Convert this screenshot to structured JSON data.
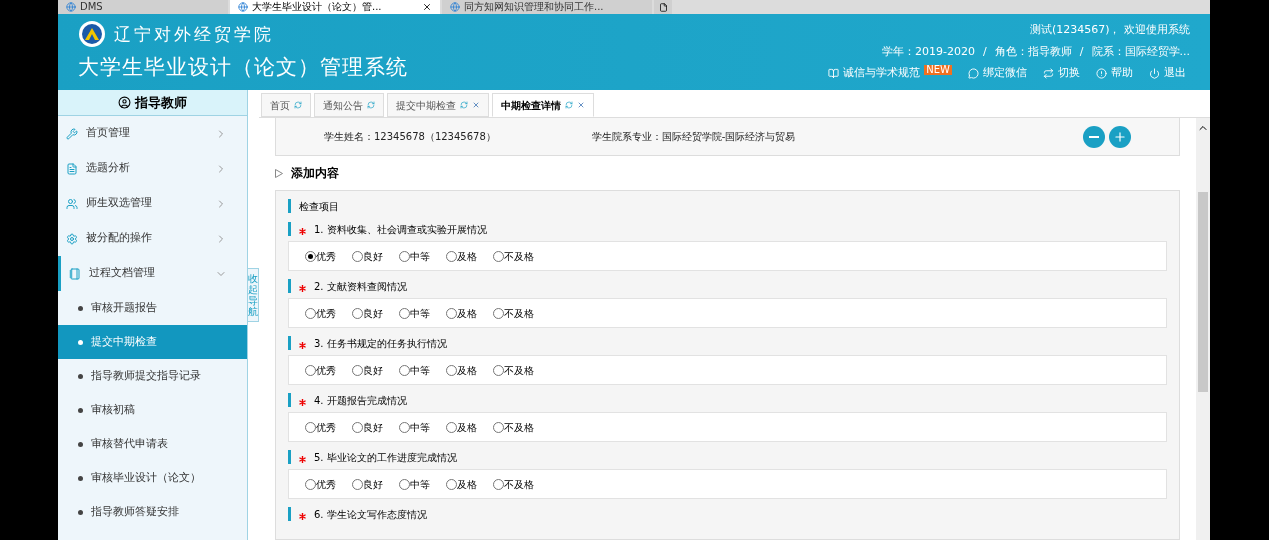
{
  "browser_tabs": [
    {
      "label": "DMS",
      "selected": false
    },
    {
      "label": "大学生毕业设计（论文）管...",
      "selected": true,
      "closable": true
    },
    {
      "label": "同方知网知识管理和协同工作...",
      "selected": false
    }
  ],
  "header": {
    "school": "辽宁对外经贸学院",
    "title": "大学生毕业设计（论文）管理系统",
    "welcome": "测试(1234567)， 欢迎使用系统",
    "year": "学年：2019-2020",
    "role": "角色：指导教师",
    "dept": "院系：国际经贸学...",
    "separator": "/",
    "links": [
      {
        "kind": "book",
        "label": "诚信与学术规范",
        "badge": "NEW"
      },
      {
        "kind": "wechat",
        "label": "绑定微信"
      },
      {
        "kind": "switch",
        "label": "切换"
      },
      {
        "kind": "help",
        "label": "帮助"
      },
      {
        "kind": "power",
        "label": "退出"
      }
    ]
  },
  "sidebar": {
    "title": "指导教师",
    "collapse_label": "收起导航",
    "items": [
      {
        "kind": "tools",
        "label": "首页管理",
        "expanded": false
      },
      {
        "kind": "doc",
        "label": "选题分析",
        "expanded": false
      },
      {
        "kind": "people",
        "label": "师生双选管理",
        "expanded": false
      },
      {
        "kind": "gear",
        "label": "被分配的操作",
        "expanded": false
      },
      {
        "kind": "file",
        "label": "过程文档管理",
        "expanded": true,
        "children": [
          {
            "label": "审核开题报告",
            "selected": false
          },
          {
            "label": "提交中期检查",
            "selected": true
          },
          {
            "label": "指导教师提交指导记录",
            "selected": false
          },
          {
            "label": "审核初稿",
            "selected": false
          },
          {
            "label": "审核替代申请表",
            "selected": false
          },
          {
            "label": "审核毕业设计（论文）",
            "selected": false
          },
          {
            "label": "指导教师答疑安排",
            "selected": false
          }
        ]
      }
    ]
  },
  "tabs": [
    {
      "label": "首页",
      "selected": false,
      "closable": false
    },
    {
      "label": "通知公告",
      "selected": false,
      "closable": false
    },
    {
      "label": "提交中期检查",
      "selected": false,
      "closable": true
    },
    {
      "label": "中期检查详情",
      "selected": true,
      "closable": true
    }
  ],
  "student": {
    "name": "学生姓名：12345678（12345678）",
    "major": "学生院系专业：国际经贸学院-国际经济与贸易"
  },
  "add_content": "添加内容",
  "section_title": "检查项目",
  "questions": [
    {
      "required": true,
      "label": "1. 资料收集、社会调查或实验开展情况",
      "options": [
        {
          "label": "优秀",
          "selected": true
        },
        {
          "label": "良好",
          "selected": false
        },
        {
          "label": "中等",
          "selected": false
        },
        {
          "label": "及格",
          "selected": false
        },
        {
          "label": "不及格",
          "selected": false
        }
      ]
    },
    {
      "required": true,
      "label": "2. 文献资料查阅情况",
      "options": [
        {
          "label": "优秀",
          "selected": false
        },
        {
          "label": "良好",
          "selected": false
        },
        {
          "label": "中等",
          "selected": false
        },
        {
          "label": "及格",
          "selected": false
        },
        {
          "label": "不及格",
          "selected": false
        }
      ]
    },
    {
      "required": true,
      "label": "3. 任务书规定的任务执行情况",
      "options": [
        {
          "label": "优秀",
          "selected": false
        },
        {
          "label": "良好",
          "selected": false
        },
        {
          "label": "中等",
          "selected": false
        },
        {
          "label": "及格",
          "selected": false
        },
        {
          "label": "不及格",
          "selected": false
        }
      ]
    },
    {
      "required": true,
      "label": "4. 开题报告完成情况",
      "options": [
        {
          "label": "优秀",
          "selected": false
        },
        {
          "label": "良好",
          "selected": false
        },
        {
          "label": "中等",
          "selected": false
        },
        {
          "label": "及格",
          "selected": false
        },
        {
          "label": "不及格",
          "selected": false
        }
      ]
    },
    {
      "required": true,
      "label": "5. 毕业论文的工作进度完成情况",
      "options": [
        {
          "label": "优秀",
          "selected": false
        },
        {
          "label": "良好",
          "selected": false
        },
        {
          "label": "中等",
          "selected": false
        },
        {
          "label": "及格",
          "selected": false
        },
        {
          "label": "不及格",
          "selected": false
        }
      ]
    },
    {
      "required": true,
      "label": "6. 学生论文写作态度情况"
    }
  ]
}
